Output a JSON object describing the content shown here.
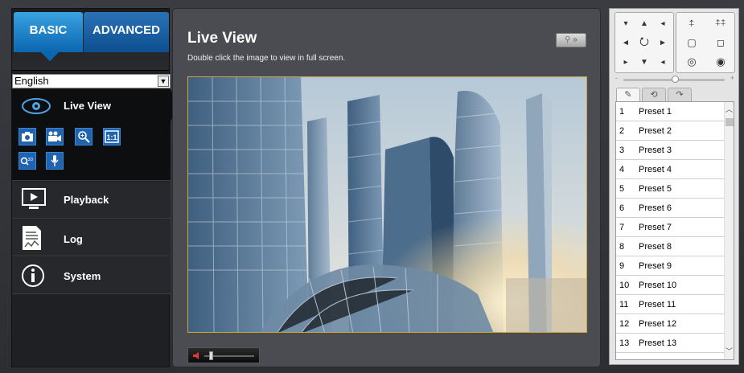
{
  "tabs": {
    "basic": "BASIC",
    "advanced": "ADVANCED"
  },
  "language": {
    "selected": "English"
  },
  "nav": {
    "live_view": "Live View",
    "playback": "Playback",
    "log": "Log",
    "system": "System"
  },
  "main": {
    "title": "Live View",
    "subtitle": "Double click the image to view in full screen.",
    "fullscreen_button": "»"
  },
  "preset_tabs": [
    "preset-tab",
    "tour-tab",
    "patrol-tab"
  ],
  "presets": [
    {
      "num": "1",
      "name": "Preset 1"
    },
    {
      "num": "2",
      "name": "Preset 2"
    },
    {
      "num": "3",
      "name": "Preset 3"
    },
    {
      "num": "4",
      "name": "Preset 4"
    },
    {
      "num": "5",
      "name": "Preset 5"
    },
    {
      "num": "6",
      "name": "Preset 6"
    },
    {
      "num": "7",
      "name": "Preset 7"
    },
    {
      "num": "8",
      "name": "Preset 8"
    },
    {
      "num": "9",
      "name": "Preset 9"
    },
    {
      "num": "10",
      "name": "Preset 10"
    },
    {
      "num": "11",
      "name": "Preset 11"
    },
    {
      "num": "12",
      "name": "Preset 12"
    },
    {
      "num": "13",
      "name": "Preset 13"
    }
  ],
  "colors": {
    "accent": "#0a66b0",
    "video_border": "#c9a63c"
  }
}
